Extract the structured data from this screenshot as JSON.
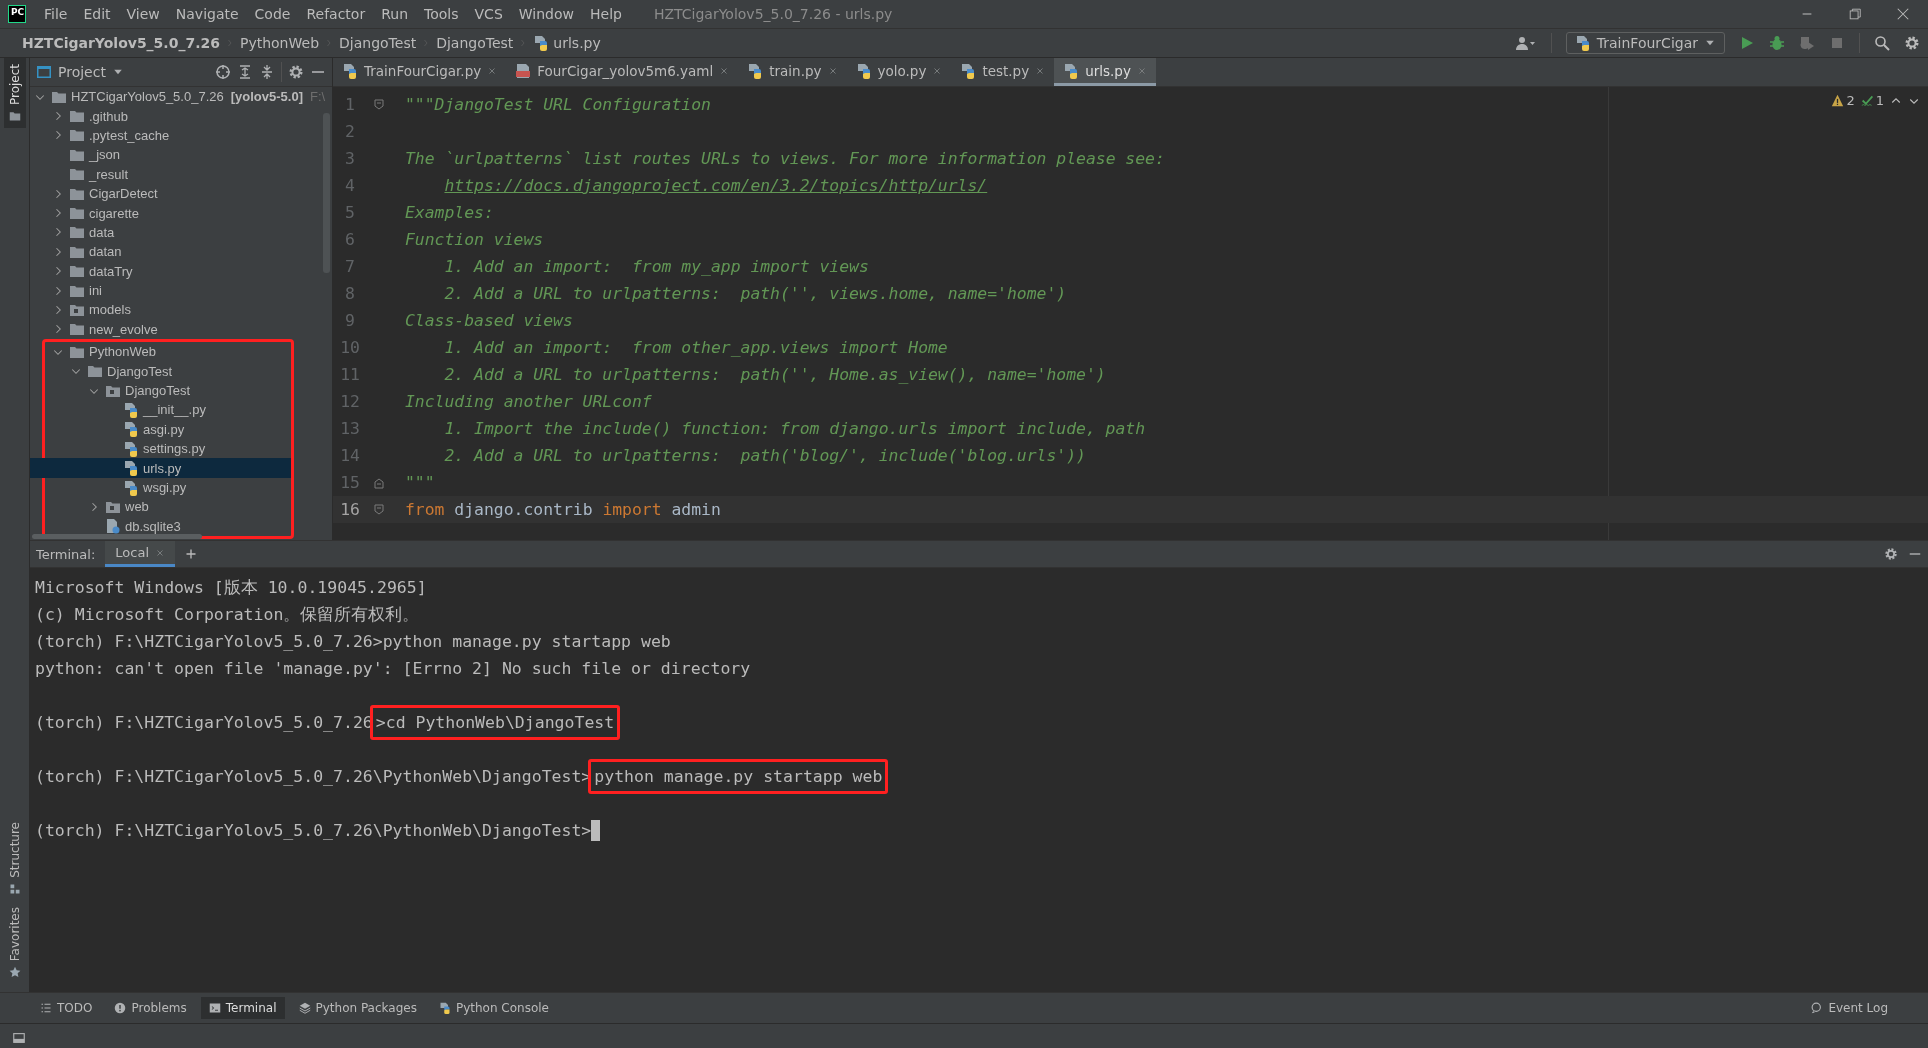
{
  "window": {
    "logo": "PC",
    "title": "HZTCigarYolov5_5.0_7.26 - urls.py"
  },
  "menu": [
    "File",
    "Edit",
    "View",
    "Navigate",
    "Code",
    "Refactor",
    "Run",
    "Tools",
    "VCS",
    "Window",
    "Help"
  ],
  "breadcrumb": [
    {
      "label": "HZTCigarYolov5_5.0_7.26",
      "kind": "project"
    },
    {
      "label": "PythonWeb",
      "kind": "folder"
    },
    {
      "label": "DjangoTest",
      "kind": "folder"
    },
    {
      "label": "DjangoTest",
      "kind": "folder"
    },
    {
      "label": "urls.py",
      "kind": "python"
    }
  ],
  "run_config": {
    "label": "TrainFourCigar"
  },
  "side_tabs": [
    {
      "label": "Project",
      "selected": true,
      "kind": "project"
    },
    {
      "label": "Structure",
      "selected": false,
      "kind": "structure"
    },
    {
      "label": "Favorites",
      "selected": false,
      "kind": "favorites"
    }
  ],
  "project_panel": {
    "title": "Project",
    "tree": [
      {
        "label": "HZTCigarYolov5_5.0_7.26",
        "tag": "[yolov5-5.0]",
        "path": "F:\\",
        "kind": "folder",
        "expanded": true,
        "selected": false,
        "children": [
          {
            "label": ".github",
            "kind": "folder",
            "expanded": false,
            "selected": false
          },
          {
            "label": ".pytest_cache",
            "kind": "folder",
            "expanded": false,
            "selected": false
          },
          {
            "label": "_json",
            "kind": "folder",
            "selected": false
          },
          {
            "label": "_result",
            "kind": "folder",
            "selected": false
          },
          {
            "label": "CigarDetect",
            "kind": "folder",
            "expanded": false,
            "selected": false
          },
          {
            "label": "cigarette",
            "kind": "folder",
            "expanded": false,
            "selected": false
          },
          {
            "label": "data",
            "kind": "folder",
            "expanded": false,
            "selected": false
          },
          {
            "label": "datan",
            "kind": "folder",
            "expanded": false,
            "selected": false
          },
          {
            "label": "dataTry",
            "kind": "folder",
            "expanded": false,
            "selected": false
          },
          {
            "label": "ini",
            "kind": "folder",
            "expanded": false,
            "selected": false
          },
          {
            "label": "models",
            "kind": "package",
            "expanded": false,
            "selected": false
          },
          {
            "label": "new_evolve",
            "kind": "folder",
            "expanded": false,
            "selected": false
          },
          {
            "label": "PythonWeb",
            "kind": "folder",
            "expanded": true,
            "selected": false,
            "highlighted": true,
            "children": [
              {
                "label": "DjangoTest",
                "kind": "folder",
                "expanded": true,
                "selected": false,
                "children": [
                  {
                    "label": "DjangoTest",
                    "kind": "package",
                    "expanded": true,
                    "selected": false,
                    "children": [
                      {
                        "label": "__init__.py",
                        "kind": "python",
                        "selected": false
                      },
                      {
                        "label": "asgi.py",
                        "kind": "python",
                        "selected": false
                      },
                      {
                        "label": "settings.py",
                        "kind": "python",
                        "selected": false
                      },
                      {
                        "label": "urls.py",
                        "kind": "python",
                        "selected": true
                      },
                      {
                        "label": "wsgi.py",
                        "kind": "python",
                        "selected": false
                      }
                    ]
                  },
                  {
                    "label": "web",
                    "kind": "package",
                    "expanded": false,
                    "selected": false
                  },
                  {
                    "label": "db.sqlite3",
                    "kind": "database",
                    "selected": false
                  }
                ]
              }
            ]
          }
        ]
      }
    ]
  },
  "editor": {
    "tabs": [
      {
        "label": "TrainFourCigar.py",
        "kind": "python",
        "selected": false
      },
      {
        "label": "FourCigar_yolov5m6.yaml",
        "kind": "yaml",
        "selected": false
      },
      {
        "label": "train.py",
        "kind": "python",
        "selected": false
      },
      {
        "label": "yolo.py",
        "kind": "python",
        "selected": false
      },
      {
        "label": "test.py",
        "kind": "python",
        "selected": false
      },
      {
        "label": "urls.py",
        "kind": "python",
        "selected": true
      }
    ],
    "inspections": {
      "warnings": "2",
      "checks": "1"
    },
    "lines": [
      {
        "number": "1",
        "current": false,
        "fold_start": true,
        "segments": [
          {
            "text": "\"\"\"DjangoTest URL Configuration",
            "kind": "doc"
          }
        ]
      },
      {
        "number": "2",
        "current": false
      },
      {
        "number": "3",
        "current": false,
        "segments": [
          {
            "text": "The `urlpatterns` list routes URLs to views. For more information please see:",
            "kind": "doc"
          }
        ]
      },
      {
        "number": "4",
        "current": false,
        "indent": true,
        "segments": [
          {
            "text": "https://docs.djangoproject.com/en/3.2/topics/http/urls/",
            "kind": "link"
          }
        ]
      },
      {
        "number": "5",
        "current": false,
        "segments": [
          {
            "text": "Examples:",
            "kind": "doc"
          }
        ]
      },
      {
        "number": "6",
        "current": false,
        "segments": [
          {
            "text": "Function views",
            "kind": "doc"
          }
        ]
      },
      {
        "number": "7",
        "current": false,
        "indent": true,
        "segments": [
          {
            "text": "1. Add an import:  from my_app import views",
            "kind": "doc"
          }
        ]
      },
      {
        "number": "8",
        "current": false,
        "indent": true,
        "segments": [
          {
            "text": "2. Add a URL to urlpatterns:  path('', views.home, name='home')",
            "kind": "doc"
          }
        ]
      },
      {
        "number": "9",
        "current": false,
        "segments": [
          {
            "text": "Class-based views",
            "kind": "doc"
          }
        ]
      },
      {
        "number": "10",
        "current": false,
        "indent": true,
        "segments": [
          {
            "text": "1. Add an import:  from other_app.views import Home",
            "kind": "doc"
          }
        ]
      },
      {
        "number": "11",
        "current": false,
        "indent": true,
        "segments": [
          {
            "text": "2. Add a URL to urlpatterns:  path('', Home.as_view(), name='home')",
            "kind": "doc"
          }
        ]
      },
      {
        "number": "12",
        "current": false,
        "segments": [
          {
            "text": "Including another URLconf",
            "kind": "doc"
          }
        ]
      },
      {
        "number": "13",
        "current": false,
        "indent": true,
        "segments": [
          {
            "text": "1. Import the include() function: from django.urls import include, path",
            "kind": "doc"
          }
        ]
      },
      {
        "number": "14",
        "current": false,
        "indent": true,
        "segments": [
          {
            "text": "2. Add a URL to urlpatterns:  path('blog/', include('blog.urls'))",
            "kind": "doc"
          }
        ]
      },
      {
        "number": "15",
        "current": false,
        "fold_end": true,
        "segments": [
          {
            "text": "\"\"\"",
            "kind": "doc"
          }
        ]
      },
      {
        "number": "16",
        "current": true,
        "fold_start": true,
        "segments": [
          {
            "text": "from",
            "kind": "keyword"
          },
          {
            "text": " django.contrib ",
            "kind": "plain"
          },
          {
            "text": "import",
            "kind": "keyword"
          },
          {
            "text": " admin",
            "kind": "plain"
          }
        ]
      }
    ]
  },
  "terminal": {
    "title": "Terminal:",
    "tabs": [
      {
        "label": "Local",
        "selected": true
      }
    ],
    "lines": [
      {
        "cursor": false,
        "parts": [
          {
            "text": "Microsoft Windows [版本 10.0.19045.2965]",
            "highlighted": false
          }
        ]
      },
      {
        "cursor": false,
        "parts": [
          {
            "text": "(c) Microsoft Corporation。保留所有权利。",
            "highlighted": false
          }
        ]
      },
      {
        "cursor": false,
        "parts": [
          {
            "text": "(torch) F:\\HZTCigarYolov5_5.0_7.26>python manage.py startapp web",
            "highlighted": false
          }
        ]
      },
      {
        "cursor": false,
        "parts": [
          {
            "text": "python: can't open file 'manage.py': [Errno 2] No such file or directory",
            "highlighted": false
          }
        ]
      },
      {
        "cursor": false,
        "blank_before": true,
        "parts": [
          {
            "text": "(torch) F:\\HZTCigarYolov5_5.0_7.26",
            "highlighted": false
          },
          {
            "text": ">cd PythonWeb\\DjangoTest",
            "highlighted": true
          }
        ]
      },
      {
        "cursor": false,
        "blank_before": true,
        "parts": [
          {
            "text": "(torch) F:\\HZTCigarYolov5_5.0_7.26\\PythonWeb\\DjangoTest>",
            "highlighted": false
          },
          {
            "text": "python manage.py startapp web",
            "highlighted": true
          }
        ]
      },
      {
        "cursor": true,
        "blank_before": true,
        "parts": [
          {
            "text": "(torch) F:\\HZTCigarYolov5_5.0_7.26\\PythonWeb\\DjangoTest>",
            "highlighted": false
          }
        ]
      }
    ]
  },
  "tool_windows": [
    {
      "label": "TODO",
      "kind": "todo",
      "selected": false
    },
    {
      "label": "Problems",
      "kind": "problems",
      "selected": false
    },
    {
      "label": "Terminal",
      "kind": "terminal",
      "selected": true
    },
    {
      "label": "Python Packages",
      "kind": "packages",
      "selected": false
    },
    {
      "label": "Python Console",
      "kind": "console",
      "selected": false
    }
  ],
  "event_log": "Event Log"
}
